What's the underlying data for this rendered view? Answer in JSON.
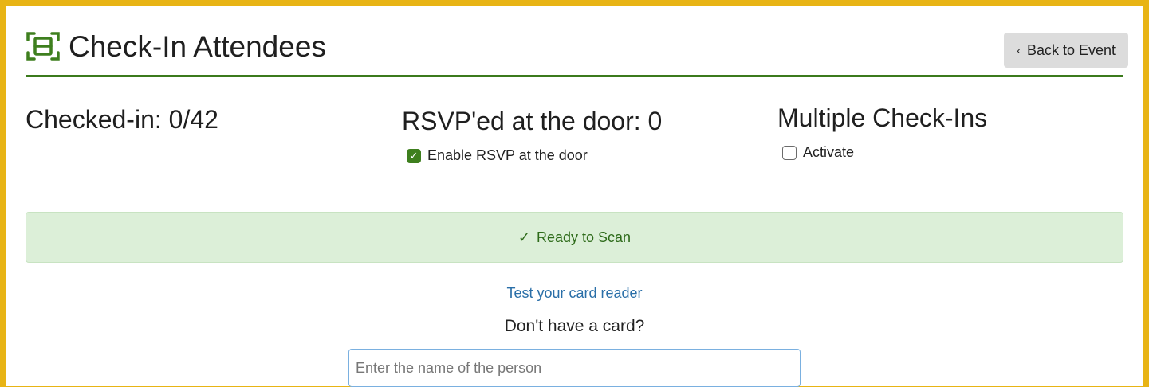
{
  "header": {
    "title": "Check-In Attendees",
    "icon": "scanner-icon",
    "back_button": {
      "label": "Back to Event",
      "icon": "chevron-left-icon"
    }
  },
  "stats": {
    "checked_in": "Checked-in: 0/42",
    "rsvp_at_door": "RSVP'ed at the door: 0",
    "multiple_checkins": "Multiple Check-Ins"
  },
  "options": {
    "enable_rsvp": {
      "label": "Enable RSVP at the door",
      "checked": true
    },
    "activate": {
      "label": "Activate",
      "checked": false
    }
  },
  "status": {
    "text": "Ready to Scan",
    "icon": "check-icon"
  },
  "card_reader_link": "Test your card reader",
  "no_card": {
    "prompt": "Don't have a card?",
    "input": {
      "value": "",
      "placeholder": "Enter the name of the person"
    }
  },
  "colors": {
    "frame_border": "#e8b415",
    "accent_green": "#3b7a1c",
    "alert_bg": "#dcefd8",
    "link": "#2a6fa8"
  }
}
